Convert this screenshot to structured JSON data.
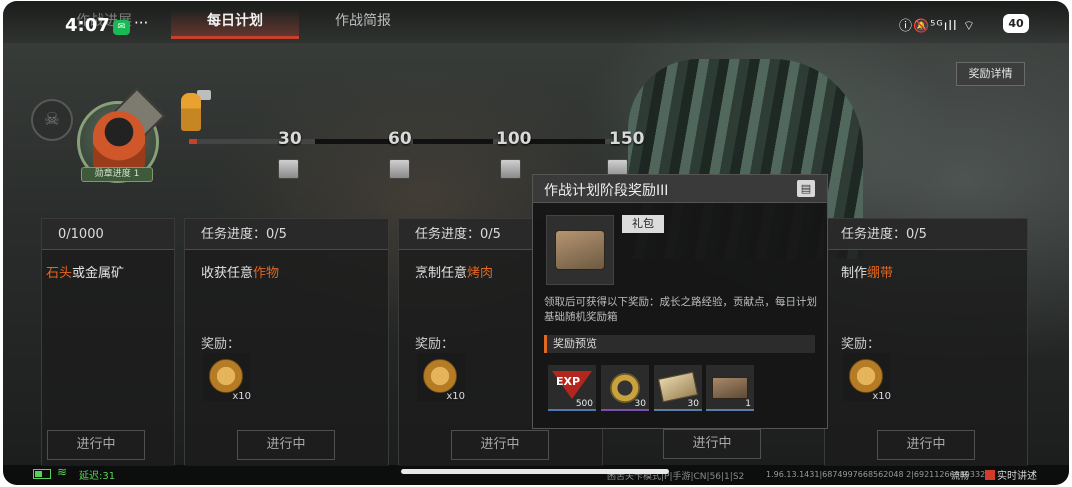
{
  "status_bar": {
    "time": "4:07",
    "dots": "···",
    "right_icons": "ⓘ🔕⁵ᴳıll ⌔",
    "battery": "40"
  },
  "tabs": [
    {
      "label": "作战进展",
      "active": false
    },
    {
      "label": "每日计划",
      "active": true
    },
    {
      "label": "作战简报",
      "active": false
    }
  ],
  "reward_detail_button": "奖励详情",
  "medal": {
    "label": "勋章进度 1"
  },
  "progress": {
    "milestones": [
      "30",
      "60",
      "100",
      "150"
    ],
    "accent_color": "#c6412c"
  },
  "task_cards": [
    {
      "progress_label": "0/1000",
      "title_prefix": "",
      "title_highlight": "石头",
      "title_suffix": "或金属矿",
      "reward_label": "",
      "reward_qty": "",
      "button": "进行中"
    },
    {
      "progress_label": "任务进度：0/5",
      "title_prefix": "收获任意",
      "title_highlight": "作物",
      "title_suffix": "",
      "reward_label": "奖励：",
      "reward_qty": "x10",
      "button": "进行中"
    },
    {
      "progress_label": "任务进度：0/5",
      "title_prefix": "烹制任意",
      "title_highlight": "烤肉",
      "title_suffix": "",
      "reward_label": "奖励：",
      "reward_qty": "x10",
      "button": "进行中"
    },
    {
      "progress_label": "",
      "title_prefix": "",
      "title_highlight": "",
      "title_suffix": "",
      "reward_label": "",
      "reward_qty": "",
      "button": "进行中"
    },
    {
      "progress_label": "任务进度：0/5",
      "title_prefix": "制作",
      "title_highlight": "绷带",
      "title_suffix": "",
      "reward_label": "奖励：",
      "reward_qty": "x10",
      "button": "进行中"
    }
  ],
  "popup": {
    "title": "作战计划阶段奖励III",
    "tag": "礼包",
    "description": "领取后可获得以下奖励：成长之路经验，贡献点，每日计划基础随机奖励箱",
    "preview_label": "奖励预览",
    "items": [
      {
        "icon": "exp-icon",
        "text": "EXP",
        "qty": "500"
      },
      {
        "icon": "medal-icon",
        "qty": "30"
      },
      {
        "icon": "ticket-icon",
        "qty": "30"
      },
      {
        "icon": "crate-icon",
        "qty": "1"
      }
    ]
  },
  "bottom": {
    "latency": "延迟:31",
    "server": "困苦关卡模式|P|手游|CN|56|1|S2",
    "build": "1.96.13.1431|6874997668562048 2|6921126633933258",
    "smooth": "流畅",
    "brand": "实时讲述"
  }
}
